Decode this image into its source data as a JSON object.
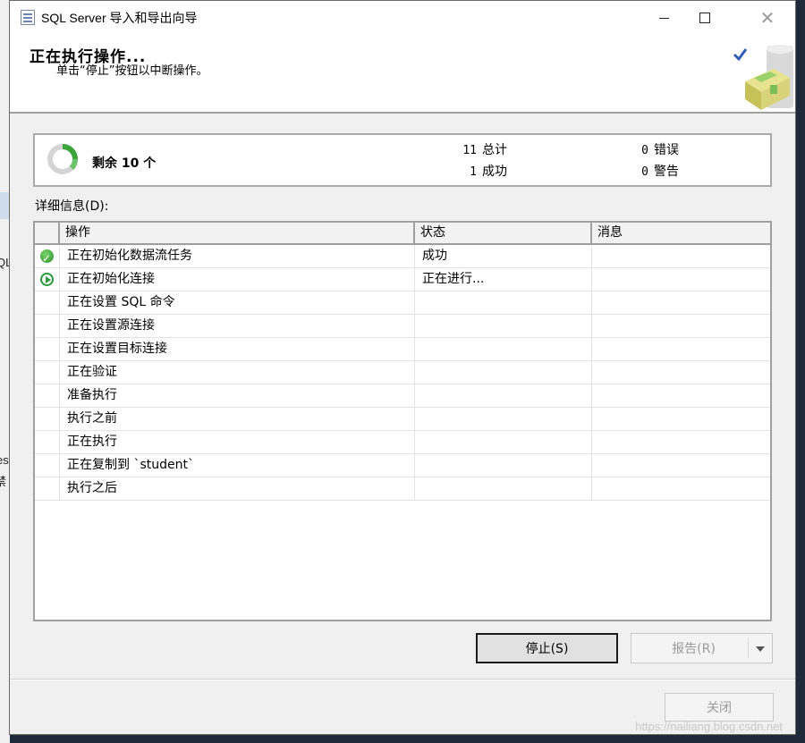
{
  "window": {
    "title": "SQL Server 导入和导出向导"
  },
  "header": {
    "title": "正在执行操作...",
    "subtitle": "单击“停止”按钮以中断操作。",
    "logo_icon": "wizard-check-icon"
  },
  "summary": {
    "remaining": "剩余 10 个",
    "total_count": "11",
    "total_label": "总计",
    "success_count": "1",
    "success_label": "成功",
    "error_count": "0",
    "error_label": "错误",
    "warning_count": "0",
    "warning_label": "警告",
    "progress_icon": "spinner-icon"
  },
  "details": {
    "label": "详细信息(D):",
    "columns": [
      "操作",
      "状态",
      "消息"
    ],
    "rows": [
      {
        "icon": "success",
        "action": "正在初始化数据流任务",
        "status": "成功",
        "message": ""
      },
      {
        "icon": "running",
        "action": "正在初始化连接",
        "status": "正在进行...",
        "message": ""
      },
      {
        "icon": "",
        "action": "正在设置 SQL 命令",
        "status": "",
        "message": ""
      },
      {
        "icon": "",
        "action": "正在设置源连接",
        "status": "",
        "message": ""
      },
      {
        "icon": "",
        "action": "正在设置目标连接",
        "status": "",
        "message": ""
      },
      {
        "icon": "",
        "action": "正在验证",
        "status": "",
        "message": ""
      },
      {
        "icon": "",
        "action": "准备执行",
        "status": "",
        "message": ""
      },
      {
        "icon": "",
        "action": "执行之前",
        "status": "",
        "message": ""
      },
      {
        "icon": "",
        "action": "正在执行",
        "status": "",
        "message": ""
      },
      {
        "icon": "",
        "action": "正在复制到 `student`",
        "status": "",
        "message": ""
      },
      {
        "icon": "",
        "action": "执行之后",
        "status": "",
        "message": ""
      }
    ]
  },
  "buttons": {
    "stop": "停止(S)",
    "report": "报告(R)",
    "close": "关闭"
  },
  "background": {
    "fragment_1": "QL",
    "fragment_2": "es",
    "fragment_3": "禁"
  },
  "watermark": "https://nailiang.blog.csdn.net"
}
